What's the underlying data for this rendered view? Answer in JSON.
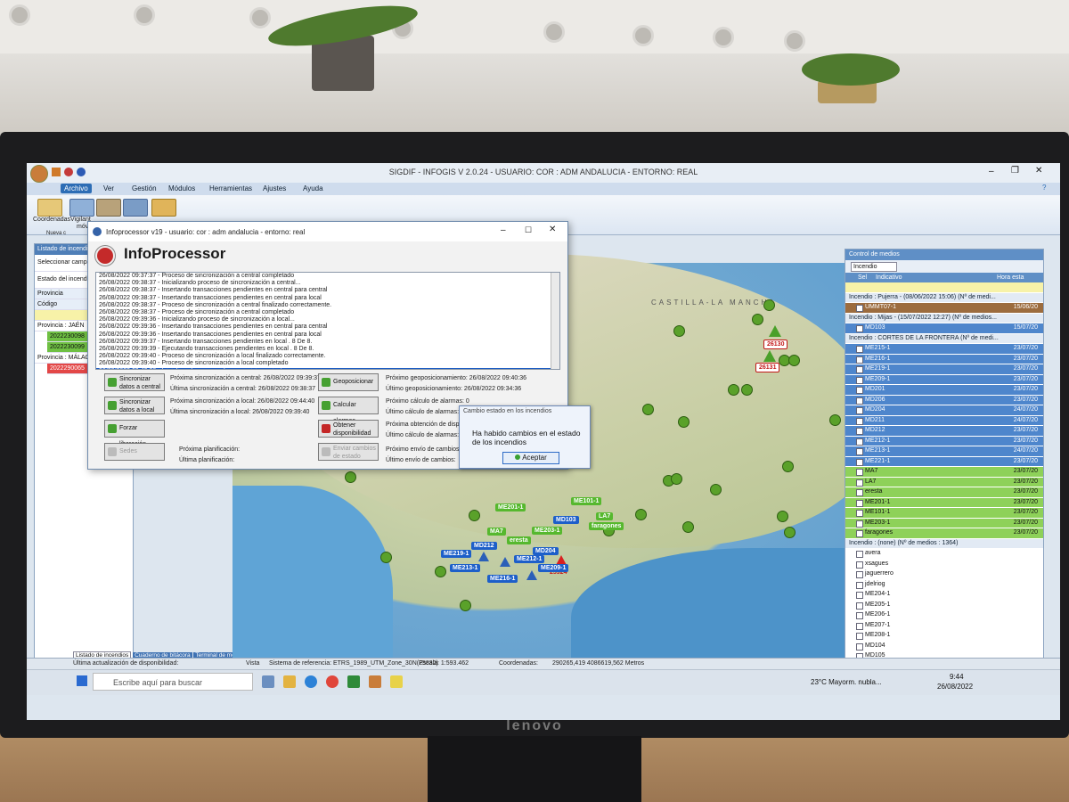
{
  "app": {
    "title": "SIGDIF - INFOGIS V 2.0.24 - USUARIO: COR : ADM ANDALUCIA - ENTORNO: REAL",
    "menu": [
      "Archivo",
      "Ver",
      "Gestión",
      "Módulos",
      "Herramientas",
      "Ajustes",
      "Ayuda"
    ],
    "ribbon": [
      "Coordenadas",
      "Vigilant",
      "móvil",
      "Nueva c"
    ],
    "monitor_brand": "lenovo"
  },
  "left_panel": {
    "header": "Listado de incendios",
    "select_label": "Seleccionar campañ",
    "state_label": "Estado del incendio",
    "col_provincia": "Provincia",
    "col_codigo": "Código",
    "group1": "Provincia : JAÉN",
    "code1": "2022230098",
    "code2": "2022230099",
    "group2": "Provincia : MÁLAG",
    "code3": "2022290065",
    "tabs": [
      "Listado de incendios",
      "Cuaderno de bitácora",
      "Terminal de mensajes"
    ]
  },
  "map": {
    "region_label": "CASTILLA-LA MANCHA",
    "fire_labels": [
      "26130",
      "26131",
      "25924"
    ],
    "unit_labels": [
      "ME201-1",
      "ME101-1",
      "MD103",
      "LA7",
      "faragones",
      "MA7",
      "ME203-1",
      "eresta",
      "MD212",
      "ME219-1",
      "MD204",
      "ME213-1",
      "ME212-1",
      "ME209-1",
      "ME216-1"
    ]
  },
  "infoprocessor": {
    "window_title": "Infoprocessor v19 - usuario: cor : adm andalucia - entorno: real",
    "heading": "InfoProcessor",
    "log": [
      "26/08/2022 09:37:37 - Proceso de sincronización a central completado",
      "26/08/2022 09:38:37 - Inicializando proceso de sincronización a central...",
      "26/08/2022 09:38:37 - Insertando transacciones pendientes en central para central",
      "26/08/2022 09:38:37 - Insertando transacciones pendientes en central para local",
      "26/08/2022 09:38:37 - Proceso de sincronización a central finalizado correctamente.",
      "26/08/2022 09:38:37 - Proceso de sincronización a central completado",
      "26/08/2022 09:39:36 - Inicializando proceso de sincronización a local...",
      "26/08/2022 09:39:36 - Insertando transacciones pendientes en central para central",
      "26/08/2022 09:39:36 - Insertando transacciones pendientes en central para local",
      "26/08/2022 09:39:37 - Insertando transacciones pendientes en local . 8 De 8.",
      "26/08/2022 09:39:39 - Ejecutando transacciones pendientes en local . 8 De 8.",
      "26/08/2022 09:39:40 - Proceso de sincronización a local finalizado correctamente.",
      "26/08/2022 09:39:40 - Proceso de sincronización a local completado",
      "26/08/2022 09:40:36 - Inicializando proceso de geoposicionamiento..."
    ],
    "btn_sync_central": "Sincronizar datos a central",
    "btn_sync_local": "Sincronizar datos a local",
    "btn_forzar": "Forzar liberación",
    "btn_sedes": "Sedes",
    "btn_geo": "Geoposicionar",
    "btn_alarmas": "Calcular alarmas",
    "btn_disp": "Obtener disponibilidad",
    "btn_enviar": "Enviar cambios de estado",
    "next_central": "Próxima sincronización a central: 26/08/2022 09:39:37",
    "last_central": "Última sincronización a central: 26/08/2022 09:38:37",
    "next_local": "Próxima sincronización a local: 26/08/2022 09:44:40",
    "last_local": "Última sincronización a local: 26/08/2022 09:39:40",
    "next_plan": "Próxima planificación:",
    "last_plan": "Última planificación:",
    "next_geo": "Próximo geoposicionamiento: 26/08/2022 09:40:36",
    "last_geo": "Último geoposicionamiento: 26/08/2022 09:34:36",
    "next_alarm": "Próximo cálculo de alarmas: 0",
    "last_alarm": "Último cálculo de alarmas:",
    "next_disp": "Próxima obtención de disponib",
    "last_disp": "Último cálculo de alarmas:",
    "next_send": "Próximo envío de cambios:",
    "last_send": "Último envío de cambios:"
  },
  "dialog": {
    "title": "Cambio estado en los incendios",
    "message": "Ha habido cambios en el estado de los incendios",
    "ok": "Aceptar"
  },
  "control_medios": {
    "title": "Control de medios",
    "filter": "Incendio",
    "col_sel": "Sel",
    "col_indicativo": "Indicativo",
    "col_hora": "Hora esta",
    "rows": [
      {
        "kind": "group",
        "text": "Incendio : Pujerra - (08/06/2022 15:06) (Nº de medi..."
      },
      {
        "kind": "brown",
        "ind": "UMMT07-1",
        "date": "15/06/20"
      },
      {
        "kind": "group",
        "text": "Incendio : Mijas - (15/07/2022 12:27) (Nº de medios..."
      },
      {
        "kind": "blue",
        "ind": "MD103",
        "date": "15/07/20"
      },
      {
        "kind": "group",
        "text": "Incendio : CORTES DE LA FRONTERA (Nº de medi..."
      },
      {
        "kind": "blue",
        "ind": "ME215-1",
        "date": "23/07/20"
      },
      {
        "kind": "blue",
        "ind": "ME216-1",
        "date": "23/07/20"
      },
      {
        "kind": "blue",
        "ind": "ME219-1",
        "date": "23/07/20"
      },
      {
        "kind": "blue",
        "ind": "ME209-1",
        "date": "23/07/20"
      },
      {
        "kind": "blue",
        "ind": "MD201",
        "date": "23/07/20"
      },
      {
        "kind": "blue",
        "ind": "MD206",
        "date": "23/07/20"
      },
      {
        "kind": "blue",
        "ind": "MD204",
        "date": "24/07/20"
      },
      {
        "kind": "blue",
        "ind": "MD211",
        "date": "24/07/20"
      },
      {
        "kind": "blue",
        "ind": "MD212",
        "date": "23/07/20"
      },
      {
        "kind": "blue",
        "ind": "ME212-1",
        "date": "23/07/20"
      },
      {
        "kind": "blue",
        "ind": "ME213-1",
        "date": "24/07/20"
      },
      {
        "kind": "blue",
        "ind": "ME221-1",
        "date": "23/07/20"
      },
      {
        "kind": "green",
        "ind": "MA7",
        "date": "23/07/20"
      },
      {
        "kind": "green",
        "ind": "LA7",
        "date": "23/07/20"
      },
      {
        "kind": "green",
        "ind": "eresta",
        "date": "23/07/20"
      },
      {
        "kind": "green",
        "ind": "ME201-1",
        "date": "23/07/20"
      },
      {
        "kind": "green",
        "ind": "ME101-1",
        "date": "23/07/20"
      },
      {
        "kind": "green",
        "ind": "ME203-1",
        "date": "23/07/20"
      },
      {
        "kind": "green",
        "ind": "faragones",
        "date": "23/07/20"
      },
      {
        "kind": "group",
        "text": "Incendio : (none) (Nº de medios : 1364)"
      },
      {
        "kind": "white",
        "ind": "avera",
        "date": ""
      },
      {
        "kind": "white",
        "ind": "xsagues",
        "date": ""
      },
      {
        "kind": "white",
        "ind": "jaguerrero",
        "date": ""
      },
      {
        "kind": "white",
        "ind": "jdelriog",
        "date": ""
      },
      {
        "kind": "white",
        "ind": "ME204-1",
        "date": ""
      },
      {
        "kind": "white",
        "ind": "ME205-1",
        "date": ""
      },
      {
        "kind": "white",
        "ind": "ME206-1",
        "date": ""
      },
      {
        "kind": "white",
        "ind": "ME207-1",
        "date": ""
      },
      {
        "kind": "white",
        "ind": "ME208-1",
        "date": ""
      },
      {
        "kind": "white",
        "ind": "MD104",
        "date": ""
      },
      {
        "kind": "white",
        "ind": "MD105",
        "date": ""
      },
      {
        "kind": "white",
        "ind": "MD106",
        "date": ""
      },
      {
        "kind": "white",
        "ind": "MD107",
        "date": ""
      }
    ]
  },
  "status": {
    "update": "Última actualización de disponibilidad:",
    "vista": "Vista",
    "srs": "Sistema de referencia: ETRS_1989_UTM_Zone_30N(25830)",
    "scale": "Escala: 1:593.462",
    "coords_label": "Coordenadas:",
    "coords": "290265,419 4086619,562 Metros"
  },
  "taskbar": {
    "search": "Escribe aquí para buscar",
    "weather": "23°C  Mayorm. nubla...",
    "time": "9:44",
    "date": "26/08/2022"
  }
}
